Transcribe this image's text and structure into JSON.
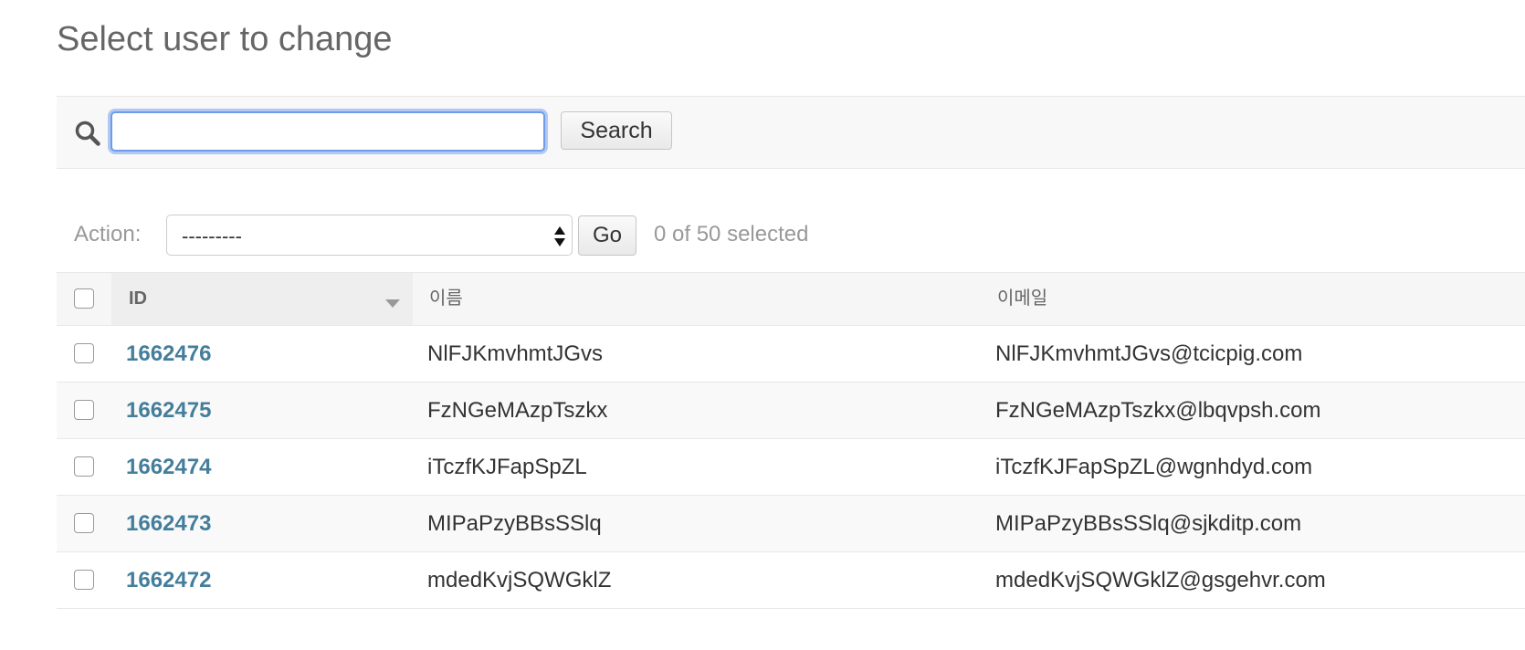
{
  "page": {
    "title": "Select user to change"
  },
  "search": {
    "value": "",
    "button_label": "Search",
    "icon": "search-icon"
  },
  "actions": {
    "label": "Action:",
    "selected_option": "---------",
    "go_label": "Go",
    "selection_count": "0 of 50 selected"
  },
  "table": {
    "columns": {
      "id": "ID",
      "name": "이름",
      "email": "이메일"
    },
    "sorted_column": "ID",
    "rows": [
      {
        "id": "1662476",
        "name": "NlFJKmvhmtJGvs",
        "email": "NlFJKmvhmtJGvs@tcicpig.com"
      },
      {
        "id": "1662475",
        "name": "FzNGeMAzpTszkx",
        "email": "FzNGeMAzpTszkx@lbqvpsh.com"
      },
      {
        "id": "1662474",
        "name": "iTczfKJFapSpZL",
        "email": "iTczfKJFapSpZL@wgnhdyd.com"
      },
      {
        "id": "1662473",
        "name": "MIPaPzyBBsSSlq",
        "email": "MIPaPzyBBsSSlq@sjkditp.com"
      },
      {
        "id": "1662472",
        "name": "mdedKvjSQWGklZ",
        "email": "mdedKvjSQWGklZ@gsgehvr.com"
      }
    ]
  },
  "colors": {
    "link": "#447e9b",
    "focus_ring": "#6f9ce6",
    "muted_text": "#999999",
    "title_text": "#666666"
  }
}
